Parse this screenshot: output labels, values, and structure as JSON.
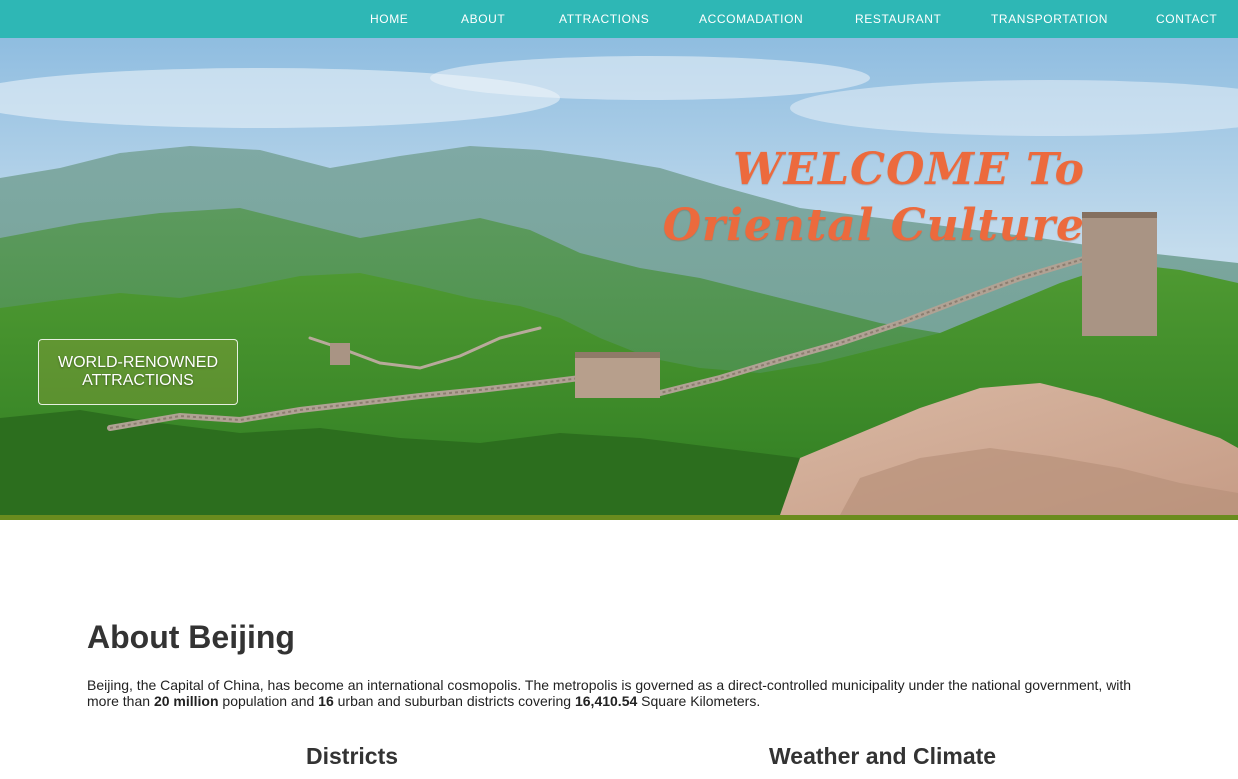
{
  "nav": {
    "items": [
      {
        "label": "HOME"
      },
      {
        "label": "ABOUT"
      },
      {
        "label": "ATTRACTIONS"
      },
      {
        "label": "ACCOMADATION"
      },
      {
        "label": "RESTAURANT"
      },
      {
        "label": "TRANSPORTATION"
      },
      {
        "label": "CONTACT"
      }
    ],
    "background_color": "#2eb7b5"
  },
  "hero": {
    "title_line1": "WELCOME To",
    "title_line2": "Oriental Culture",
    "title_color": "#ec6a3d",
    "cta_line1": "WORLD-RENOWNED",
    "cta_line2": "ATTRACTIONS",
    "image_subject": "great-wall-landscape"
  },
  "about": {
    "title": "About Beijing",
    "text_part1": "Beijing, the Capital of China, has become an international cosmopolis. The metropolis is governed as a direct-controlled municipality under the national government, with more than ",
    "population": "20 million",
    "text_part2": " population and ",
    "districts_count": "16",
    "text_part3": " urban and suburban districts covering ",
    "area": "16,410.54",
    "text_part4": " Square Kilometers.",
    "headings": {
      "districts": "Districts",
      "weather": "Weather and Climate"
    }
  }
}
